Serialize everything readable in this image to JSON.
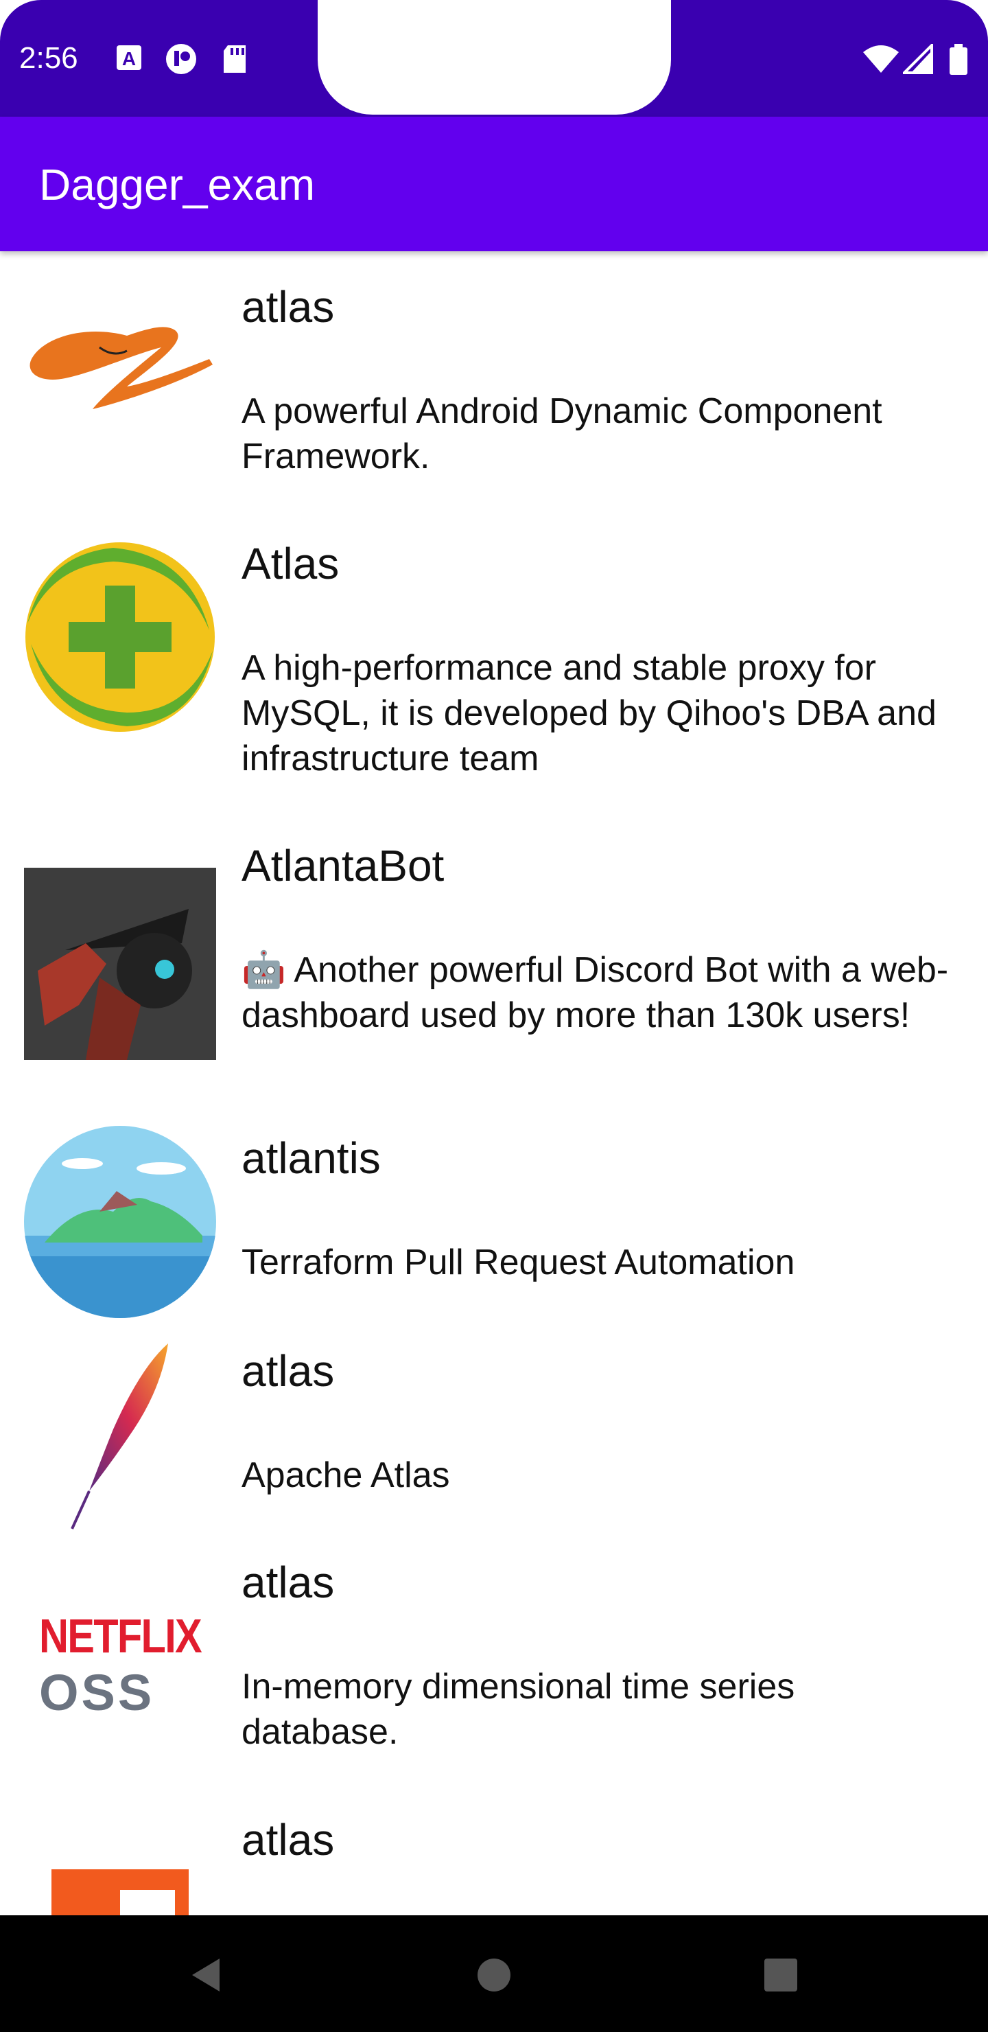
{
  "status_bar": {
    "time": "2:56",
    "icons": [
      "text-a-icon",
      "circle-app-icon",
      "sd-card-icon",
      "wifi-icon",
      "signal-icon",
      "battery-icon"
    ]
  },
  "app_bar": {
    "title": "Dagger_exam"
  },
  "repos": [
    {
      "name": "atlas",
      "description": "A powerful Android Dynamic Component Framework.",
      "icon": "alibaba-logo-icon"
    },
    {
      "name": "Atlas",
      "description": "A high-performance and stable proxy for MySQL, it is developed by Qihoo's DBA and infrastructure team",
      "icon": "qihoo-360-logo-icon"
    },
    {
      "name": "AtlantaBot",
      "description": "🤖 Another powerful Discord Bot with a web-dashboard used by more than 130k users!",
      "icon": "atlantabot-avatar-icon"
    },
    {
      "name": "atlantis",
      "description": "Terraform Pull Request Automation",
      "icon": "atlantis-island-icon"
    },
    {
      "name": "atlas",
      "description": "Apache Atlas",
      "icon": "apache-feather-icon"
    },
    {
      "name": "atlas",
      "description": "In-memory dimensional time series database.",
      "icon": "netflix-oss-logo-icon"
    },
    {
      "name": "atlas",
      "description": "",
      "icon": "orange-logo-icon"
    }
  ],
  "netflix_logo": {
    "line1": "NETFLIX",
    "line2": "OSS"
  },
  "nav_bar": {
    "buttons": [
      "back-icon",
      "home-icon",
      "recents-icon"
    ]
  },
  "colors": {
    "status_bar": "#3a00b0",
    "app_bar": "#6200ee",
    "nav_bar": "#000000"
  }
}
